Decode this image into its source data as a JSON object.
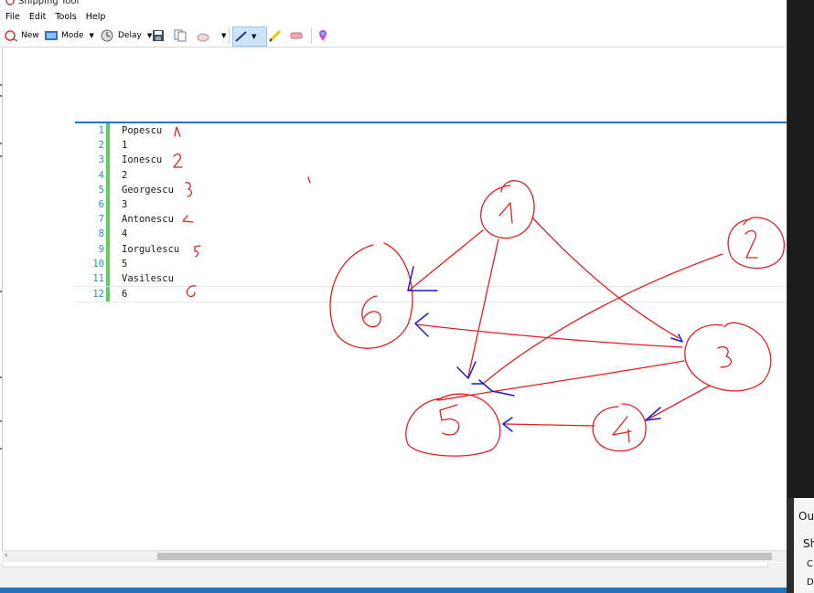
{
  "window": {
    "title": "Snipping Tool"
  },
  "menu": [
    "File",
    "Edit",
    "Tools",
    "Help"
  ],
  "toolbar": {
    "new_label": "New",
    "mode_label": "Mode",
    "delay_label": "Delay",
    "dropdown_glyph": "▼"
  },
  "editor": {
    "lines": [
      {
        "num": "1",
        "text": "Popescu"
      },
      {
        "num": "2",
        "text": "1"
      },
      {
        "num": "3",
        "text": "Ionescu"
      },
      {
        "num": "4",
        "text": "2"
      },
      {
        "num": "5",
        "text": "Georgescu"
      },
      {
        "num": "6",
        "text": "3"
      },
      {
        "num": "7",
        "text": "Antonescu"
      },
      {
        "num": "8",
        "text": "4"
      },
      {
        "num": "9",
        "text": "Iorgulescu"
      },
      {
        "num": "10",
        "text": "5"
      },
      {
        "num": "11",
        "text": "Vasilescu"
      },
      {
        "num": "12",
        "text": "6"
      }
    ]
  },
  "sidepanel": {
    "label_1": "Ou",
    "label_2": "Sh",
    "label_3": "C",
    "label_4": "D"
  },
  "colors": {
    "ink_red": "#e02020",
    "ink_blue": "#1a1ad0",
    "accent": "#1f73c0",
    "gutter_green": "#5ad05a"
  }
}
